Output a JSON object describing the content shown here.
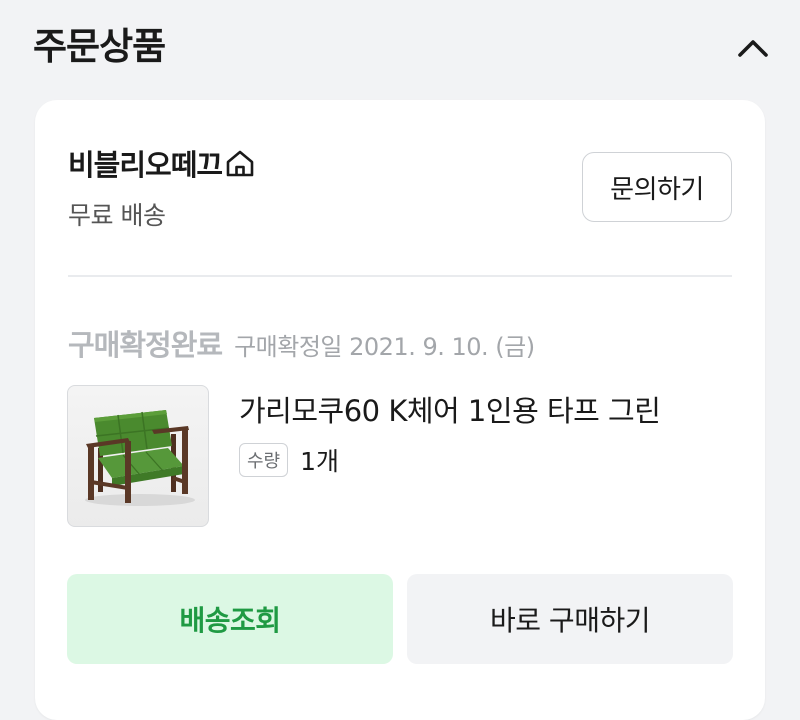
{
  "section": {
    "title": "주문상품",
    "collapse_icon": "chevron-up-icon"
  },
  "store": {
    "name": "비블리오떼끄",
    "home_icon": "home-icon",
    "shipping": "무료 배송",
    "inquiry_label": "문의하기"
  },
  "order": {
    "status": "구매확정완료",
    "confirm_date": "구매확정일 2021. 9. 10. (금)"
  },
  "product": {
    "name": "가리모쿠60 K체어 1인용 타프 그린",
    "qty_label": "수량",
    "qty_value": "1개",
    "image_alt": "green armchair"
  },
  "actions": {
    "track_label": "배송조회",
    "buy_again_label": "바로 구매하기"
  },
  "colors": {
    "page_bg": "#f2f3f5",
    "card_bg": "#ffffff",
    "accent_green": "#1f9a43",
    "accent_green_bg": "#dcf8e4",
    "muted_text": "#b5b8bc",
    "chair_green": "#4a8a2e",
    "chair_wood": "#5a3826"
  }
}
